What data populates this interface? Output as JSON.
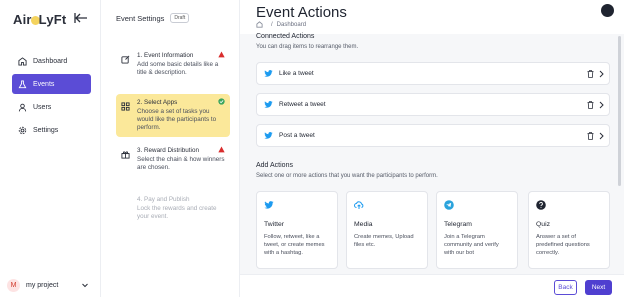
{
  "sidebar": {
    "logo": "AirLyft",
    "items": [
      {
        "label": "Dashboard",
        "icon": "grid-icon"
      },
      {
        "label": "Events",
        "icon": "flask-icon"
      },
      {
        "label": "Users",
        "icon": "user-icon"
      },
      {
        "label": "Settings",
        "icon": "gear-icon"
      }
    ],
    "project": {
      "avatar": "M",
      "name": "my project"
    }
  },
  "steps_panel": {
    "title": "Event Settings",
    "badge": "Draft",
    "steps": [
      {
        "title": "1. Event Information",
        "desc": "Add some basic details like a title & description.",
        "status": "warning"
      },
      {
        "title": "2. Select Apps",
        "desc": "Choose a set of tasks you would like the participants to perform.",
        "status": "done"
      },
      {
        "title": "3. Reward Distribution",
        "desc": "Select the chain & how winners are chosen.",
        "status": "warning"
      },
      {
        "title": "4. Pay and Publish",
        "desc": "Lock the rewards and create your event.",
        "status": "disabled"
      }
    ]
  },
  "main": {
    "title": "Event Actions",
    "breadcrumb": "Dashboard",
    "connected_label": "Connected Actions",
    "connected_sub": "You can drag items to rearrange them.",
    "connected": [
      "Like a tweet",
      "Retweet a tweet",
      "Post a tweet"
    ],
    "add_label": "Add Actions",
    "add_sub": "Select one or more actions that you want the participants to perform.",
    "cards": [
      {
        "title": "Twitter",
        "desc": "Follow, retweet, like a tweet, or create memes with a hashtag.",
        "icon": "twitter-icon"
      },
      {
        "title": "Media",
        "desc": "Create memes, Upload files etc.",
        "icon": "upload-cloud-icon"
      },
      {
        "title": "Telegram",
        "desc": "Join a Telegram community and verify with our bot",
        "icon": "telegram-icon"
      },
      {
        "title": "Quiz",
        "desc": "Answer a set of predefined questions correctly.",
        "icon": "question-icon"
      }
    ],
    "back_label": "Back",
    "next_label": "Next"
  },
  "colors": {
    "accent": "#5b4cd6",
    "highlight": "#fbe89a",
    "twitter": "#1d9bf0",
    "warning": "#d92d2d",
    "success": "#3aa55d"
  }
}
